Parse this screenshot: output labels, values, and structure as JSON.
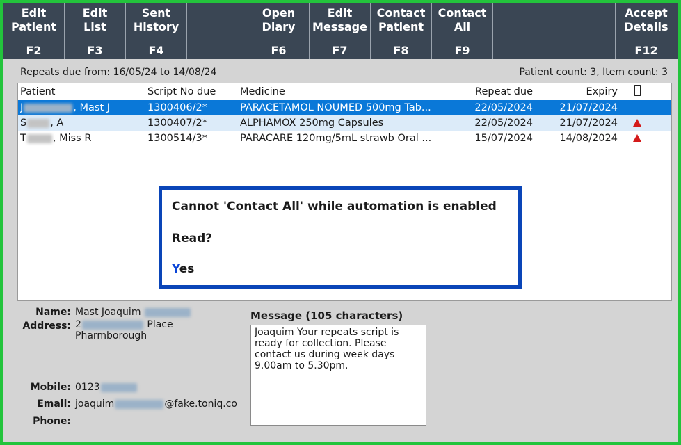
{
  "function_keys": [
    {
      "label": "Edit\nPatient",
      "key": "F2",
      "name": "edit-patient-button"
    },
    {
      "label": "Edit\nList",
      "key": "F3",
      "name": "edit-list-button"
    },
    {
      "label": "Sent\nHistory",
      "key": "F4",
      "name": "sent-history-button"
    },
    {
      "label": "",
      "key": "",
      "name": "blank-key-1"
    },
    {
      "label": "Open\nDiary",
      "key": "F6",
      "name": "open-diary-button"
    },
    {
      "label": "Edit\nMessage",
      "key": "F7",
      "name": "edit-message-button"
    },
    {
      "label": "Contact\nPatient",
      "key": "F8",
      "name": "contact-patient-button"
    },
    {
      "label": "Contact\nAll",
      "key": "F9",
      "name": "contact-all-button"
    },
    {
      "label": "",
      "key": "",
      "name": "blank-key-2"
    },
    {
      "label": "",
      "key": "",
      "name": "blank-key-3"
    },
    {
      "label": "Accept\nDetails",
      "key": "F12",
      "name": "accept-details-button"
    }
  ],
  "summary": {
    "repeats_label": "Repeats due from:",
    "from_date": "16/05/24",
    "to_word": "to",
    "to_date": "14/08/24",
    "counts": "Patient count: 3, Item count: 3"
  },
  "table": {
    "headers": {
      "patient": "Patient",
      "script": "Script No due",
      "medicine": "Medicine",
      "repeat_due": "Repeat due",
      "expiry": "Expiry",
      "contact_icon": "mobile-phone-icon"
    },
    "rows": [
      {
        "patient_initial": "J",
        "patient_rest": ", Mast J",
        "script": "1300406/2*",
        "medicine": "PARACETAMOL NOUMED 500mg  Tab...",
        "repeat_due": "22/05/2024",
        "expiry": "21/07/2024",
        "warning": false,
        "selected": true
      },
      {
        "patient_initial": "S",
        "patient_rest": ", A",
        "script": "1300407/2*",
        "medicine": "ALPHAMOX 250mg  Capsules",
        "repeat_due": "22/05/2024",
        "expiry": "21/07/2024",
        "warning": true,
        "selected": false
      },
      {
        "patient_initial": "T",
        "patient_rest": ", Miss R",
        "script": "1300514/3*",
        "medicine": "PARACARE 120mg/5mL strawb Oral ...",
        "repeat_due": "15/07/2024",
        "expiry": "14/08/2024",
        "warning": true,
        "selected": false
      }
    ]
  },
  "dialog": {
    "message": "Cannot 'Contact All' while automation is enabled",
    "question": "Read?",
    "yes_hotkey": "Y",
    "yes_rest": "es"
  },
  "details": {
    "name_label": "Name:",
    "name_value": "Mast Joaquim",
    "address_label": "Address:",
    "address_line1_start": "2",
    "address_line1_end": "Place",
    "address_line2": "Pharmborough",
    "mobile_label": "Mobile:",
    "mobile_value": "0123",
    "email_label": "Email:",
    "email_start": "joaquim",
    "email_end": "@fake.toniq.co",
    "phone_label": "Phone:"
  },
  "message": {
    "title": "Message (105 characters)",
    "body": "Joaquim Your repeats script is ready for collection. Please contact us during week days 9.00am to 5.30pm."
  },
  "colors": {
    "outer_border": "#23c43c",
    "toolbar": "#3a4654",
    "selected_row": "#0a78d8",
    "alt_row": "#dcebf9",
    "dialog_border": "#0a45b8",
    "warning": "#d41a1a"
  }
}
